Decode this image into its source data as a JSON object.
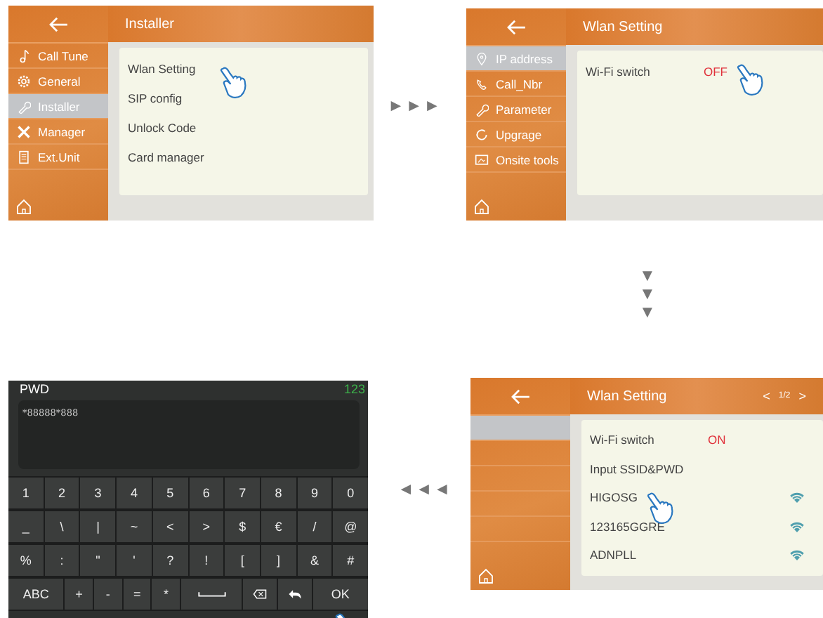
{
  "screen_installer": {
    "title": "Installer",
    "sidebar": [
      {
        "label": "Call Tune",
        "selected": false
      },
      {
        "label": "General",
        "selected": false
      },
      {
        "label": "Installer",
        "selected": true
      },
      {
        "label": "Manager",
        "selected": false
      },
      {
        "label": "Ext.Unit",
        "selected": false
      }
    ],
    "items": [
      "Wlan Setting",
      "SIP config",
      "Unlock Code",
      "Card manager"
    ]
  },
  "screen_wlan_off": {
    "title": "Wlan Setting",
    "sidebar": [
      {
        "label": "IP address",
        "selected": true
      },
      {
        "label": "Call_Nbr",
        "selected": false
      },
      {
        "label": "Parameter",
        "selected": false
      },
      {
        "label": "Upgrage",
        "selected": false
      },
      {
        "label": "Onsite tools",
        "selected": false
      }
    ],
    "rows": [
      {
        "kind": "switch",
        "label": "Wi-Fi switch",
        "value": "OFF"
      }
    ]
  },
  "screen_wlan_on": {
    "title": "Wlan Setting",
    "prev": "<",
    "page": "1/2",
    "next": ">",
    "sidebar": [
      {
        "selected": true
      },
      {
        "selected": false
      },
      {
        "selected": false
      },
      {
        "selected": false
      },
      {
        "selected": false
      }
    ],
    "rows": [
      {
        "kind": "switch",
        "label": "Wi-Fi switch",
        "value": "ON"
      },
      {
        "kind": "link",
        "label": "Input SSID&PWD"
      },
      {
        "kind": "network",
        "label": "HIGOSG"
      },
      {
        "kind": "network",
        "label": "123165GGRE"
      },
      {
        "kind": "network",
        "label": "ADNPLL"
      }
    ]
  },
  "screen_keyboard": {
    "title": "PWD",
    "mode": "123",
    "value": "*88888*888",
    "keys": [
      [
        {
          "label": "1"
        },
        {
          "label": "2"
        },
        {
          "label": "3"
        },
        {
          "label": "4"
        },
        {
          "label": "5"
        },
        {
          "label": "6"
        },
        {
          "label": "7"
        },
        {
          "label": "8"
        },
        {
          "label": "9"
        },
        {
          "label": "0"
        }
      ],
      [
        {
          "label": "_"
        },
        {
          "label": "\\"
        },
        {
          "label": "|"
        },
        {
          "label": "~"
        },
        {
          "label": "<"
        },
        {
          "label": ">"
        },
        {
          "label": "$"
        },
        {
          "label": "€"
        },
        {
          "label": "/"
        },
        {
          "label": "@"
        }
      ],
      [
        {
          "label": "%"
        },
        {
          "label": ":"
        },
        {
          "label": "\""
        },
        {
          "label": "'"
        },
        {
          "label": "?"
        },
        {
          "label": "!"
        },
        {
          "label": "["
        },
        {
          "label": "]"
        },
        {
          "label": "&"
        },
        {
          "label": "#"
        }
      ],
      [
        {
          "kind": "wide",
          "label": "ABC"
        },
        {
          "label": "+"
        },
        {
          "label": "-"
        },
        {
          "label": "="
        },
        {
          "label": "*"
        },
        {
          "kind": "space"
        },
        {
          "kind": "backspace"
        },
        {
          "kind": "enter"
        },
        {
          "kind": "wide",
          "label": "OK"
        }
      ]
    ]
  },
  "flow_arrows": [
    "►►►",
    "▼▼▼",
    "◄◄◄"
  ]
}
